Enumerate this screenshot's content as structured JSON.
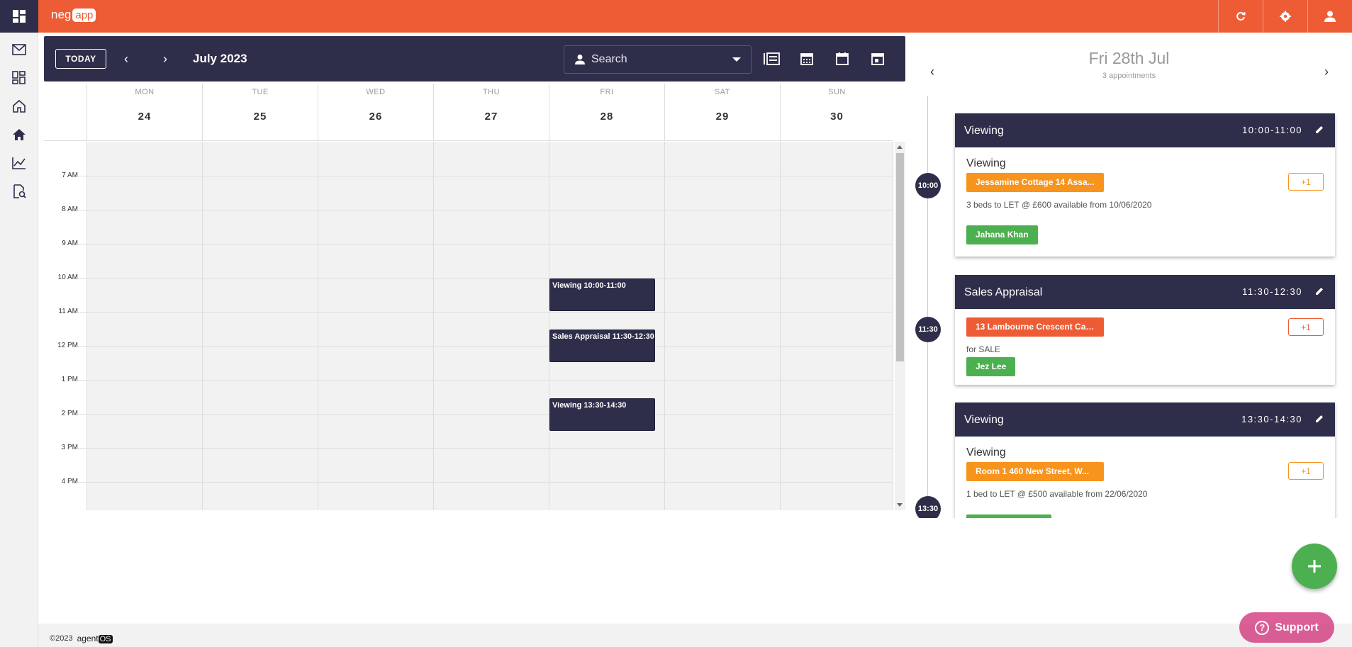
{
  "app": {
    "logo_left": "neg",
    "logo_right": "app"
  },
  "toolbar": {
    "today_label": "TODAY",
    "prev_icon": "‹",
    "next_icon": "›",
    "month_label": "July 2023",
    "search_placeholder": "Search"
  },
  "calendar": {
    "days": [
      {
        "name": "MON",
        "date": "24"
      },
      {
        "name": "TUE",
        "date": "25"
      },
      {
        "name": "WED",
        "date": "26"
      },
      {
        "name": "THU",
        "date": "27"
      },
      {
        "name": "FRI",
        "date": "28"
      },
      {
        "name": "SAT",
        "date": "29"
      },
      {
        "name": "SUN",
        "date": "30"
      }
    ],
    "times": [
      "7 AM",
      "8 AM",
      "9 AM",
      "10 AM",
      "11 AM",
      "12 PM",
      "1 PM",
      "2 PM",
      "3 PM",
      "4 PM"
    ],
    "events": [
      {
        "label": "Viewing 10:00-11:00"
      },
      {
        "label": "Sales Appraisal 11:30-12:30"
      },
      {
        "label": "Viewing 13:30-14:30"
      }
    ]
  },
  "agenda": {
    "prev_icon": "‹",
    "next_icon": "›",
    "date_label": "Fri 28th Jul",
    "count_label": "3 appointments",
    "appointments": [
      {
        "dot_time": "10:00",
        "title": "Viewing",
        "time_range": "10:00-11:00",
        "subtitle": "Viewing",
        "property": "Jessamine Cottage 14 Assa...",
        "plus": "+1",
        "description": "3 beds to LET @ £600 available from 10/06/2020",
        "person": "Jahana Khan"
      },
      {
        "dot_time": "11:30",
        "title": "Sales Appraisal",
        "time_range": "11:30-12:30",
        "subtitle": "",
        "property": "13 Lambourne Crescent Car...",
        "plus": "+1",
        "description": "for SALE",
        "person": "Jez Lee"
      },
      {
        "dot_time": "13:30",
        "title": "Viewing",
        "time_range": "13:30-14:30",
        "subtitle": "Viewing",
        "property": "Room 1 460 New Street, W...",
        "plus": "+1",
        "description": "1 bed to LET @ £500 available from 22/06/2020",
        "person": ""
      }
    ]
  },
  "footer": {
    "copyright": "©2023",
    "brand_left": "agent",
    "brand_right": "OS",
    "support_label": "Support",
    "support_icon": "?"
  },
  "colors": {
    "brand_orange": "#ee5c35",
    "navy": "#2f2e4a",
    "tag_orange": "#f7941d",
    "tag_green": "#4cb050",
    "support_pink": "#d4397f"
  }
}
